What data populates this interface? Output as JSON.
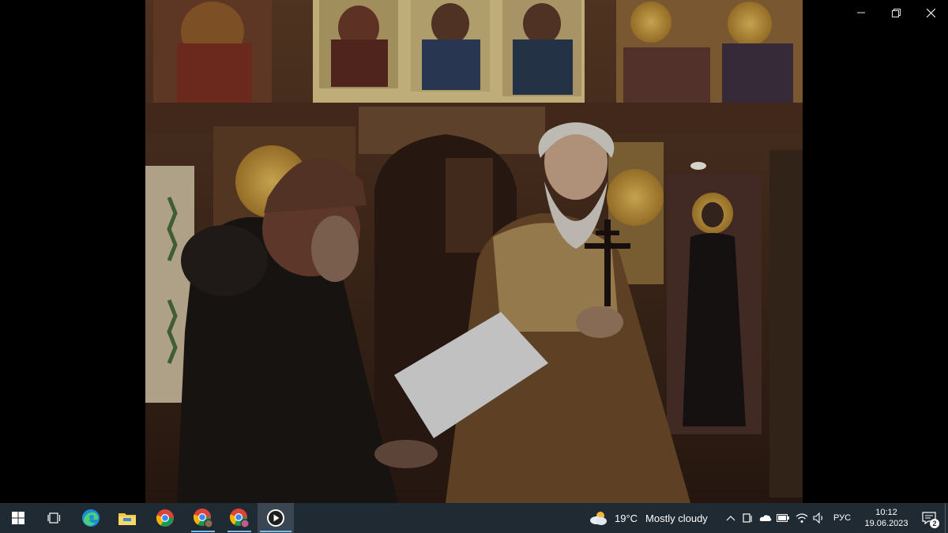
{
  "window": {
    "minimize_icon": "minimize-icon",
    "restore_icon": "restore-icon",
    "close_icon": "close-icon"
  },
  "taskbar": {
    "apps": [
      {
        "name": "start",
        "icon": "windows-logo-icon"
      },
      {
        "name": "task-view",
        "icon": "task-view-icon"
      },
      {
        "name": "edge",
        "icon": "edge-icon"
      },
      {
        "name": "file-explorer",
        "icon": "folder-icon"
      },
      {
        "name": "chrome",
        "icon": "chrome-icon"
      },
      {
        "name": "chrome-profile-1",
        "icon": "chrome-icon"
      },
      {
        "name": "chrome-profile-2",
        "icon": "chrome-icon"
      },
      {
        "name": "media-player",
        "icon": "play-icon"
      }
    ],
    "weather": {
      "temperature": "19°C",
      "condition": "Mostly cloudy",
      "icon": "cloud-sun-icon"
    },
    "tray": {
      "language": "РУС",
      "time": "10:12",
      "date": "19.06.2023",
      "notification_count": "2"
    }
  }
}
